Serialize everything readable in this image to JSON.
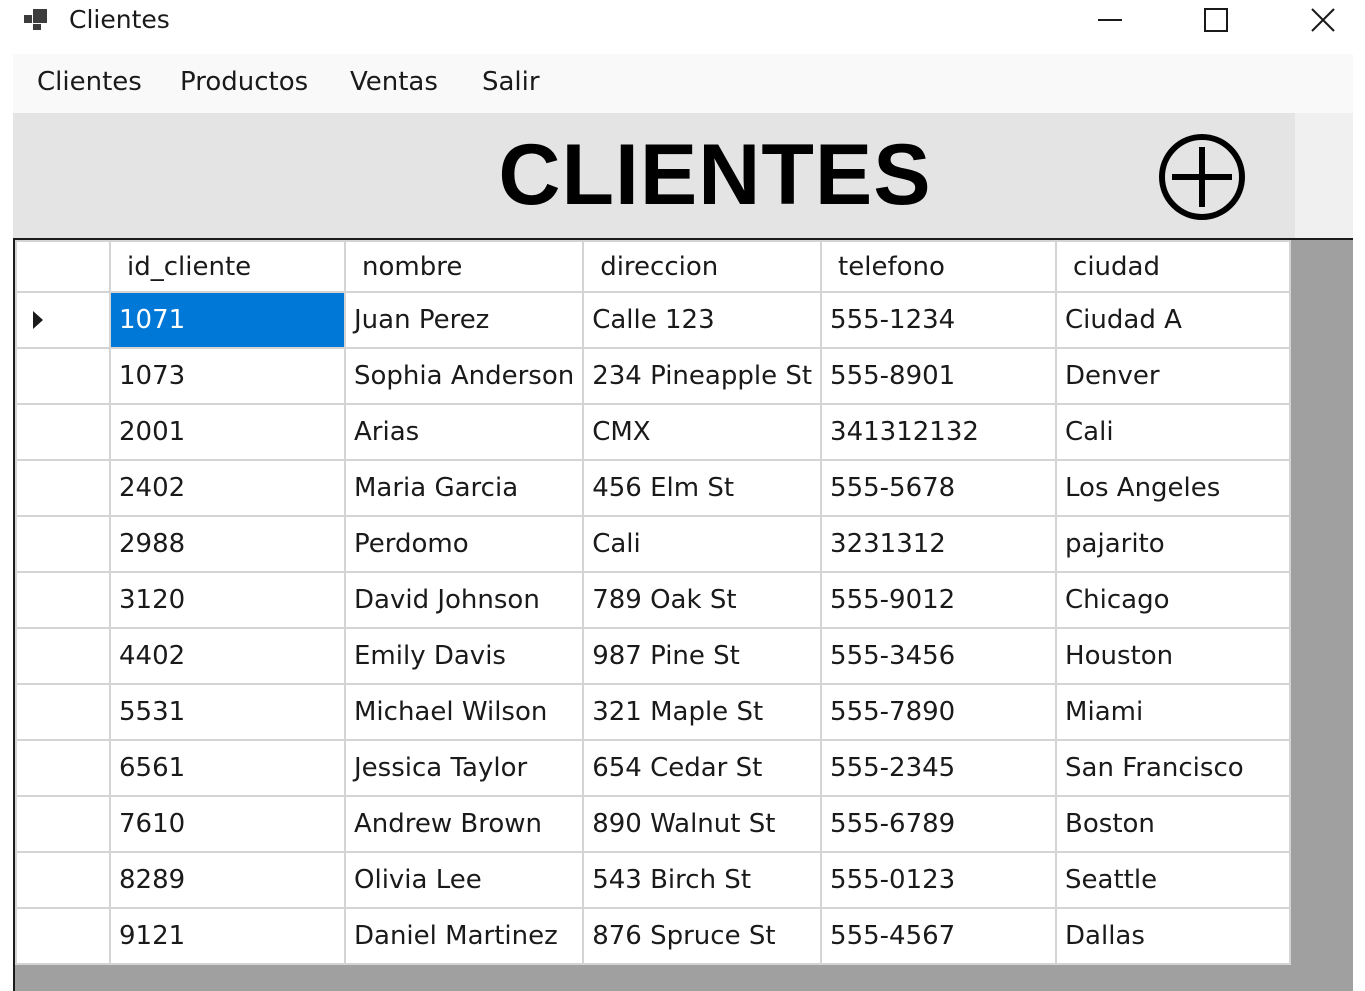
{
  "window": {
    "title": "Clientes"
  },
  "menu": {
    "items": [
      "Clientes",
      "Productos",
      "Ventas",
      "Salir"
    ]
  },
  "header": {
    "title": "CLIENTES",
    "add_icon": "plus-circle-icon"
  },
  "table": {
    "columns": [
      "id_cliente",
      "nombre",
      "direccion",
      "telefono",
      "ciudad"
    ],
    "current_row": 0,
    "selected_cell": "id_cliente",
    "rows": [
      [
        "1071",
        "Juan Perez",
        "Calle 123",
        "555-1234",
        "Ciudad A"
      ],
      [
        "1073",
        "Sophia Anderson",
        "234 Pineapple St",
        "555-8901",
        "Denver"
      ],
      [
        "2001",
        "Arias",
        "CMX",
        "341312132",
        "Cali"
      ],
      [
        "2402",
        "Maria Garcia",
        "456 Elm St",
        "555-5678",
        "Los Angeles"
      ],
      [
        "2988",
        "Perdomo",
        "Cali",
        "3231312",
        "pajarito"
      ],
      [
        "3120",
        "David Johnson",
        "789 Oak St",
        "555-9012",
        "Chicago"
      ],
      [
        "4402",
        "Emily Davis",
        "987 Pine St",
        "555-3456",
        "Houston"
      ],
      [
        "5531",
        "Michael Wilson",
        "321 Maple St",
        "555-7890",
        "Miami"
      ],
      [
        "6561",
        "Jessica Taylor",
        "654 Cedar St",
        "555-2345",
        "San Francisco"
      ],
      [
        "7610",
        "Andrew Brown",
        "890 Walnut St",
        "555-6789",
        "Boston"
      ],
      [
        "8289",
        "Olivia Lee",
        "543 Birch St",
        "555-0123",
        "Seattle"
      ],
      [
        "9121",
        "Daniel Martinez",
        "876 Spruce St",
        "555-4567",
        "Dallas"
      ]
    ]
  },
  "colors": {
    "selection": "#0078d7",
    "grid_background": "#a0a0a0",
    "header_panel": "#e4e4e4"
  }
}
